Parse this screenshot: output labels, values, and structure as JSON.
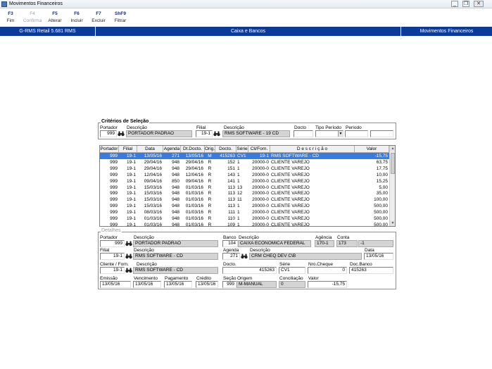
{
  "window": {
    "title": "Movimentos Financeiros",
    "controls": [
      "minimize",
      "restore",
      "close"
    ]
  },
  "toolbar": [
    {
      "key": "F3",
      "label": "Fim",
      "enabled": true
    },
    {
      "key": "F4",
      "label": "Confirma",
      "enabled": false
    },
    {
      "key": "F5",
      "label": "Alterar",
      "enabled": true
    },
    {
      "key": "F6",
      "label": "Incluir",
      "enabled": true
    },
    {
      "key": "F7",
      "label": "Excluir",
      "enabled": true
    },
    {
      "key": "ShF9",
      "label": "Filtrar",
      "enabled": true
    }
  ],
  "header_bar": {
    "left": "G-RMS Retail 5.681 RMS",
    "center": "Caixa e Bancos",
    "right": "Movimentos Financeiros",
    "color": "#0a3a9a"
  },
  "criterios": {
    "title": "Critérios de Seleção",
    "portador_label": "Portador",
    "portador_value": "999",
    "descricao_label": "Descrição",
    "descricao_value": "PORTADOR PADRAO",
    "filial_label": "Filial",
    "filial_value": "19-1",
    "descricao2_label": "Descrição",
    "descricao2_value": "RMS SOFTWARE - 19 CD",
    "docto_label": "Docto",
    "docto_value": "",
    "tipo_periodo_label": "Tipo Período",
    "tipo_periodo_value": "",
    "periodo_label": "Período",
    "periodo_from": "",
    "periodo_to": ""
  },
  "grid": {
    "columns": [
      "Portador",
      "Filial",
      "Data",
      "Agenda",
      "Dt.Docto.",
      "Orig.",
      "Docto.",
      "Série",
      "Cli/Forn.",
      "D e s c r i ç ã o",
      "Valor"
    ],
    "rows": [
      [
        "999",
        "19-1",
        "13/05/16",
        "271",
        "13/05/16",
        "M",
        "415263",
        "CV1",
        "19-1",
        "RMS SOFTWARE - CD",
        "-15,75"
      ],
      [
        "999",
        "19-1",
        "29/04/16",
        "948",
        "29/04/16",
        "R",
        "152",
        "1",
        "20000-0",
        "CLIENTE VAREJO",
        "63,75"
      ],
      [
        "999",
        "19-1",
        "29/04/16",
        "948",
        "29/04/16",
        "R",
        "151",
        "1",
        "20000-0",
        "CLIENTE VAREJO",
        "17,75"
      ],
      [
        "999",
        "19-1",
        "12/04/16",
        "948",
        "12/04/16",
        "R",
        "143",
        "1",
        "20000-0",
        "CLIENTE VAREJO",
        "10,00"
      ],
      [
        "999",
        "19-1",
        "09/04/16",
        "850",
        "09/04/16",
        "R",
        "141",
        "1",
        "20000-0",
        "CLIENTE VAREJO",
        "15,25"
      ],
      [
        "999",
        "19-1",
        "15/03/16",
        "948",
        "01/03/16",
        "R",
        "113",
        "13",
        "20000-0",
        "CLIENTE VAREJO",
        "5,00"
      ],
      [
        "999",
        "19-1",
        "15/03/16",
        "948",
        "01/03/16",
        "R",
        "113",
        "12",
        "20000-0",
        "CLIENTE VAREJO",
        "35,00"
      ],
      [
        "999",
        "19-1",
        "15/03/16",
        "948",
        "01/03/16",
        "R",
        "113",
        "11",
        "20000-0",
        "CLIENTE VAREJO",
        "100,00"
      ],
      [
        "999",
        "19-1",
        "15/03/16",
        "948",
        "01/03/16",
        "R",
        "113",
        "1",
        "20000-0",
        "CLIENTE VAREJO",
        "500,00"
      ],
      [
        "999",
        "19-1",
        "08/03/16",
        "948",
        "01/03/16",
        "R",
        "111",
        "1",
        "20000-0",
        "CLIENTE VAREJO",
        "500,00"
      ],
      [
        "999",
        "19-1",
        "01/03/16",
        "948",
        "01/03/16",
        "R",
        "110",
        "1",
        "20000-0",
        "CLIENTE VAREJO",
        "500,00"
      ],
      [
        "999",
        "19-1",
        "01/03/16",
        "948",
        "01/03/16",
        "R",
        "109",
        "1",
        "20000-0",
        "CLIENTE VAREJO",
        "500,00"
      ]
    ],
    "selected_row": 0,
    "selection_color": "#3a7be0"
  },
  "detalhes": {
    "title": "Detalhes",
    "portador_label": "Portador",
    "portador_value": "999",
    "portador_desc_label": "Descrição",
    "portador_desc_value": "PORTADOR PADRAO",
    "banco_label": "Banco",
    "banco_value": "104",
    "banco_desc_label": "Descrição",
    "banco_desc_value": "CAIXA ECONOMICA FEDERAL",
    "agencia_label": "Agência",
    "agencia_value": "170-1",
    "conta_label": "Conta",
    "conta_value": "173",
    "conta_dv": "-1",
    "filial_label": "Filial",
    "filial_value": "19-1",
    "filial_desc_label": "Descrição",
    "filial_desc_value": "RMS SOFTWARE - CD",
    "agenda_label": "Agenda",
    "agenda_value": "271",
    "agenda_desc_label": "Descrição",
    "agenda_desc_value": "CRM CHEQ DEV C\\B",
    "data_label": "Data",
    "data_value": "13/05/16",
    "cliente_label": "Cliente / Forn.",
    "cliente_value": "19-1",
    "cliente_desc_label": "Descrição",
    "cliente_desc_value": "RMS SOFTWARE - CD",
    "docto_label": "Docto.",
    "docto_value": "415263",
    "serie_label": "Série",
    "serie_value": "CV1",
    "nro_cheque_label": "Nro.Cheque",
    "nro_cheque_value": "0",
    "doc_banco_label": "Doc.Banco",
    "doc_banco_value": "415263",
    "emissao_label": "Emissão",
    "emissao_value": "13/05/16",
    "vencimento_label": "Vencimento",
    "vencimento_value": "13/05/16",
    "pagamento_label": "Pagamento",
    "pagamento_value": "13/05/16",
    "credito_label": "Crédito",
    "credito_value": "13/05/16",
    "secao_label": "Seção",
    "secao_value": "999",
    "origem_label": "Origem",
    "origem_value": "M-MANUAL",
    "conciliacao_label": "Conciliação",
    "conciliacao_value": "0",
    "valor_label": "Valor",
    "valor_value": "-15,75"
  }
}
